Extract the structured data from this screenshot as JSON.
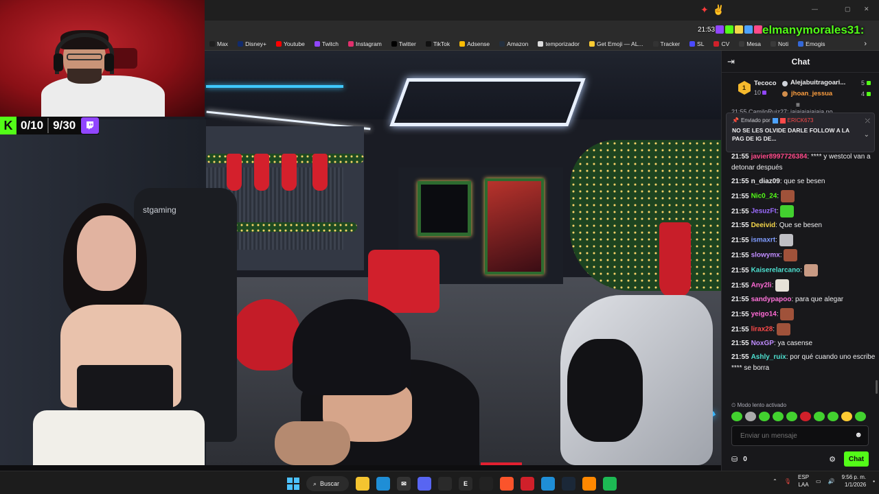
{
  "bookmarks": [
    {
      "label": "Max",
      "icon": "max-icon",
      "color": "#1f1f1f"
    },
    {
      "label": "Disney+",
      "icon": "disney-icon",
      "color": "#112a6b"
    },
    {
      "label": "Youtube",
      "icon": "youtube-icon",
      "color": "#ff0000"
    },
    {
      "label": "Twitch",
      "icon": "twitch-icon",
      "color": "#9146ff"
    },
    {
      "label": "Instagram",
      "icon": "instagram-icon",
      "color": "#e1306c"
    },
    {
      "label": "Twitter",
      "icon": "x-icon",
      "color": "#000000"
    },
    {
      "label": "TikTok",
      "icon": "tiktok-icon",
      "color": "#111111"
    },
    {
      "label": "Adsense",
      "icon": "adsense-icon",
      "color": "#fbbc04"
    },
    {
      "label": "Amazon",
      "icon": "amazon-icon",
      "color": "#232f3e"
    },
    {
      "label": "temporizador",
      "icon": "timer-icon",
      "color": "#dddddd"
    },
    {
      "label": "Get Emoji — AL...",
      "icon": "emoji-icon",
      "color": "#ffcc33"
    },
    {
      "label": "Tracker",
      "icon": "tracker-icon",
      "color": "#333333"
    },
    {
      "label": "SL",
      "icon": "sl-icon",
      "color": "#4a4aff"
    },
    {
      "label": "CV",
      "icon": "cv-icon",
      "color": "#d0202a"
    },
    {
      "label": "Mesa",
      "icon": "mesa-icon",
      "color": "#3a3a3a"
    },
    {
      "label": "Noti",
      "icon": "noti-icon",
      "color": "#3a3a3a"
    },
    {
      "label": "Emogis",
      "icon": "emogis-icon",
      "color": "#3468d8"
    }
  ],
  "bookmarks_more": "›",
  "overlay": {
    "kick_letter": "K",
    "kick_count": "0/10",
    "twitch_count": "9/30",
    "kick_color": "#53fc18",
    "twitch_color": "#9146ff"
  },
  "video": {
    "chair_brand": "stgaming"
  },
  "top_right": {
    "time": "21:53",
    "username": "elmanymorales31",
    "suffix": ":"
  },
  "chat": {
    "title": "Chat",
    "leaderboard": [
      {
        "name": "Tecoco",
        "count": "10",
        "rank": "1"
      },
      {
        "name": "Alejabuitragoari...",
        "count": "5"
      },
      {
        "name": "jhoan_jessua",
        "count": "4"
      }
    ],
    "peek_line": "21:55 CamiloRuiz27: jajajajajajaja no",
    "pinned": {
      "label": "Enviado por",
      "sender": "ERICK673",
      "message": "NO SE LES OLVIDE DARLE FOLLOW A LA PAG DE IG DE..."
    },
    "messages": [
      {
        "time": "21:55",
        "user": "javier8997726384",
        "color": "#ff4a8a",
        "text": "**** y westcol van a detonar después",
        "emote": ""
      },
      {
        "time": "21:55",
        "user": "n_diaz09",
        "color": "#efeff1",
        "text": "que se besen",
        "emote": ""
      },
      {
        "time": "21:55",
        "user": "Nic0_24",
        "color": "#53fc18",
        "text": "",
        "emote": "#a0523a"
      },
      {
        "time": "21:55",
        "user": "JesuzFt",
        "color": "#9b6cff",
        "text": "",
        "emote": "#42d12f"
      },
      {
        "time": "21:55",
        "user": "Deeivid",
        "color": "#f5d64a",
        "text": "Que se besen",
        "emote": ""
      },
      {
        "time": "21:55",
        "user": "ismaxrt",
        "color": "#7f9cff",
        "text": "",
        "emote": "#bfbfc4"
      },
      {
        "time": "21:55",
        "user": "slowymx",
        "color": "#c08cff",
        "text": "",
        "emote": "#a0523a"
      },
      {
        "time": "21:55",
        "user": "Kaiserelarcano",
        "color": "#4de0d0",
        "text": "",
        "emote": "#c89a84"
      },
      {
        "time": "21:55",
        "user": "Any2li",
        "color": "#ff6ad5",
        "text": "",
        "emote": "#e6e2d8"
      },
      {
        "time": "21:55",
        "user": "sandypapoo",
        "color": "#ff72d9",
        "text": "para que alegar",
        "emote": ""
      },
      {
        "time": "21:55",
        "user": "yeigo14",
        "color": "#ff6ad5",
        "text": "",
        "emote": "#a0523a"
      },
      {
        "time": "21:55",
        "user": "lirax28",
        "color": "#ff4a4a",
        "text": "",
        "emote": "#a0523a"
      },
      {
        "time": "21:55",
        "user": "NoxGP",
        "color": "#c08cff",
        "text": "ya casense",
        "emote": ""
      },
      {
        "time": "21:55",
        "user": "Ashly_ruix",
        "color": "#4de0d0",
        "text": "por qué cuando uno escribe **** se borra",
        "emote": ""
      }
    ],
    "slow_mode": "Modo lento activado",
    "quick_emotes": [
      "#42d12f",
      "#aaaaaa",
      "#42d12f",
      "#42d12f",
      "#42d12f",
      "#d0202a",
      "#42d12f",
      "#42d12f",
      "#ffcc33",
      "#42d12f"
    ],
    "input_placeholder": "Enviar un mensaje",
    "points": "0",
    "send_label": "Chat"
  },
  "taskbar": {
    "search_label": "Buscar",
    "lang_line1": "ESP",
    "lang_line2": "LAA",
    "time": "9:56 p. m.",
    "date": "1/1/2026",
    "apps": [
      {
        "name": "file-explorer-icon",
        "color": "#f4c430",
        "glyph": ""
      },
      {
        "name": "edge-icon",
        "color": "#1f8ed6",
        "glyph": ""
      },
      {
        "name": "app-icon",
        "color": "#333",
        "glyph": "✉"
      },
      {
        "name": "discord-icon",
        "color": "#5865f2",
        "glyph": ""
      },
      {
        "name": "obs-icon",
        "color": "#2a2a2a",
        "glyph": ""
      },
      {
        "name": "epic-icon",
        "color": "#2a2a2a",
        "glyph": "E"
      },
      {
        "name": "whatsapp-icon",
        "color": "#222",
        "glyph": ""
      },
      {
        "name": "brave-icon",
        "color": "#fb542b",
        "glyph": ""
      },
      {
        "name": "red-app-icon",
        "color": "#d0202a",
        "glyph": ""
      },
      {
        "name": "bluetooth-app-icon",
        "color": "#1f8ed6",
        "glyph": ""
      },
      {
        "name": "steam-icon",
        "color": "#1b2838",
        "glyph": ""
      },
      {
        "name": "vlc-icon",
        "color": "#ff8800",
        "glyph": ""
      },
      {
        "name": "spotify-icon",
        "color": "#1db954",
        "glyph": ""
      }
    ]
  }
}
